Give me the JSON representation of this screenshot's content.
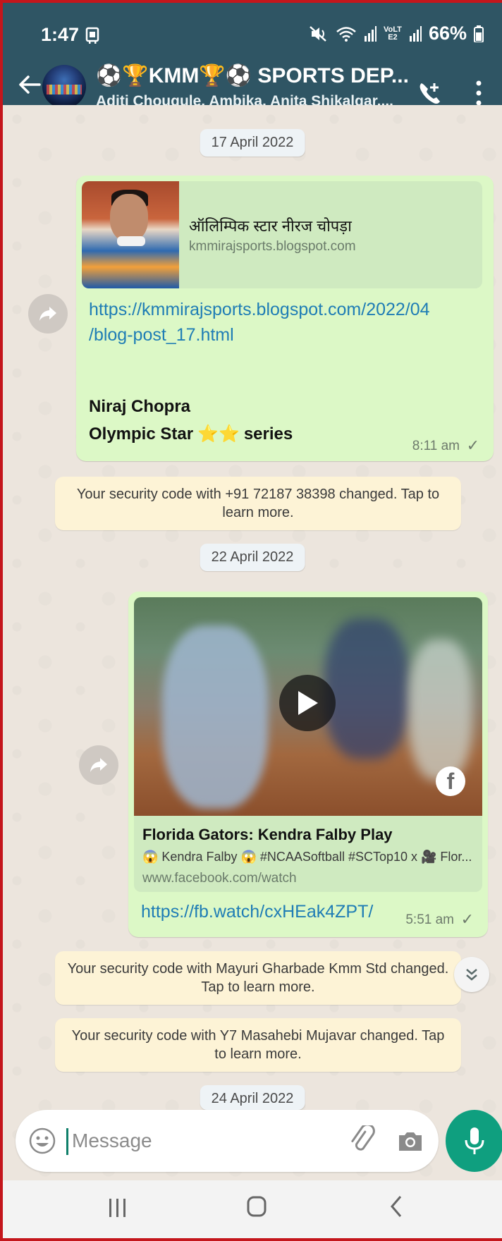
{
  "status_bar": {
    "time": "1:47",
    "network": "VoLTE2",
    "battery": "66%"
  },
  "header": {
    "title": "⚽🏆KMM🏆⚽ SPORTS DEP...",
    "subtitle": "Aditi Chougule, Ambika, Anita Shikalgar,..."
  },
  "messages": {
    "date1": "17 April 2022",
    "msg1": {
      "preview_title": "ऑलिम्पिक स्टार नीरज चोपड़ा",
      "preview_site": "kmmirajsports.blogspot.com",
      "link_line1": "https://kmmirajsports.blogspot.com/2022/04",
      "link_line2": "/blog-post_17.html",
      "text_line1": "Niraj Chopra",
      "text_line2_prefix": "Olympic Star",
      "text_line2_stars": "⭐⭐",
      "text_line2_suffix": "series",
      "time": "8:11 am",
      "tick": "✓"
    },
    "sys1": "Your security code with +91 72187 38398 changed. Tap to learn more.",
    "date2": "22 April 2022",
    "msg2": {
      "video_title": "Florida Gators: Kendra Falby Play",
      "video_desc": "😱 Kendra Falby 😱 #NCAASoftball #SCTop10 x 🎥 Flor...",
      "video_site": "www.facebook.com/watch",
      "fb_logo": "f",
      "link": "https://fb.watch/cxHEak4ZPT/",
      "time": "5:51 am",
      "tick": "✓"
    },
    "sys2": "Your security code with Mayuri Gharbade Kmm Std changed. Tap to learn more.",
    "sys3": "Your security code with Y7 Masahebi Mujavar changed. Tap to learn more.",
    "date3": "24 April 2022"
  },
  "input": {
    "placeholder": "Message"
  },
  "colors": {
    "header_bg": "#2f5564",
    "bubble_out": "#dcf8c6",
    "system_bg": "#fdf3d6",
    "mic_bg": "#0f9f7f",
    "link": "#1f7db5"
  }
}
